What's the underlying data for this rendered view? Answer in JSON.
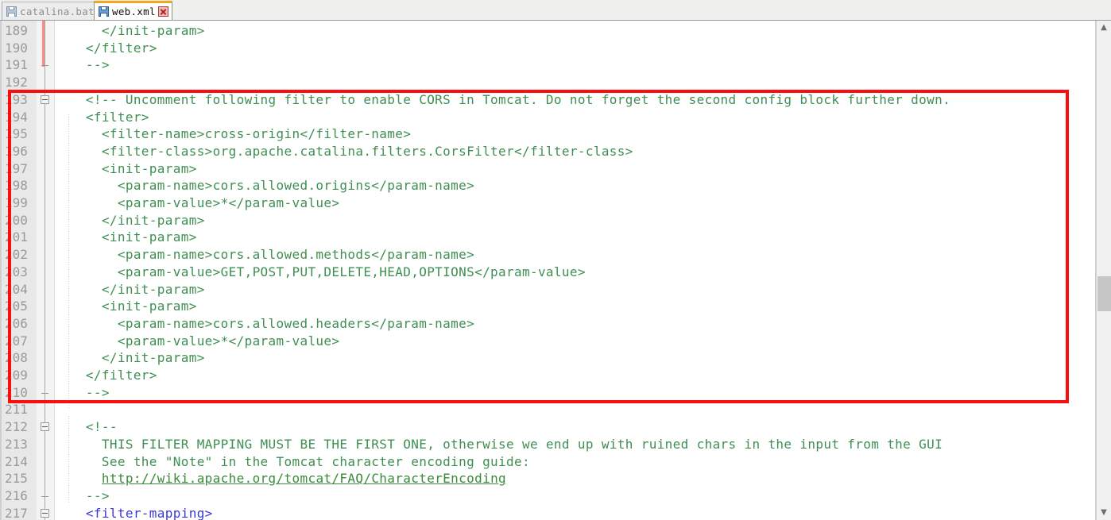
{
  "window": {
    "app": "notepad-style-xml-editor"
  },
  "tabs": [
    {
      "label": "catalina.bat",
      "active": false,
      "icon": "save-disk-icon",
      "close": "close-icon"
    },
    {
      "label": "web.xml",
      "active": true,
      "icon": "save-disk-icon",
      "close": "close-icon"
    }
  ],
  "editor": {
    "first_line": 189,
    "lines": [
      {
        "n": 189,
        "text": "      </init-param>",
        "style": "comment",
        "fold": "none"
      },
      {
        "n": 190,
        "text": "    </filter>",
        "style": "comment",
        "fold": "none"
      },
      {
        "n": 191,
        "text": "    -->",
        "style": "comment",
        "fold": "end"
      },
      {
        "n": 192,
        "text": "",
        "style": "comment",
        "fold": "none"
      },
      {
        "n": 193,
        "text": "    <!-- Uncomment following filter to enable CORS in Tomcat. Do not forget the second config block further down.",
        "style": "comment",
        "fold": "start"
      },
      {
        "n": 194,
        "text": "    <filter>",
        "style": "comment",
        "fold": "none"
      },
      {
        "n": 195,
        "text": "      <filter-name>cross-origin</filter-name>",
        "style": "comment",
        "fold": "none"
      },
      {
        "n": 196,
        "text": "      <filter-class>org.apache.catalina.filters.CorsFilter</filter-class>",
        "style": "comment",
        "fold": "none"
      },
      {
        "n": 197,
        "text": "      <init-param>",
        "style": "comment",
        "fold": "none"
      },
      {
        "n": 198,
        "text": "        <param-name>cors.allowed.origins</param-name>",
        "style": "comment",
        "fold": "none"
      },
      {
        "n": 199,
        "text": "        <param-value>*</param-value>",
        "style": "comment",
        "fold": "none"
      },
      {
        "n": 200,
        "text": "      </init-param>",
        "style": "comment",
        "fold": "none"
      },
      {
        "n": 201,
        "text": "      <init-param>",
        "style": "comment",
        "fold": "none"
      },
      {
        "n": 202,
        "text": "        <param-name>cors.allowed.methods</param-name>",
        "style": "comment",
        "fold": "none"
      },
      {
        "n": 203,
        "text": "        <param-value>GET,POST,PUT,DELETE,HEAD,OPTIONS</param-value>",
        "style": "comment",
        "fold": "none"
      },
      {
        "n": 204,
        "text": "      </init-param>",
        "style": "comment",
        "fold": "none"
      },
      {
        "n": 205,
        "text": "      <init-param>",
        "style": "comment",
        "fold": "none"
      },
      {
        "n": 206,
        "text": "        <param-name>cors.allowed.headers</param-name>",
        "style": "comment",
        "fold": "none"
      },
      {
        "n": 207,
        "text": "        <param-value>*</param-value>",
        "style": "comment",
        "fold": "none"
      },
      {
        "n": 208,
        "text": "      </init-param>",
        "style": "comment",
        "fold": "none"
      },
      {
        "n": 209,
        "text": "    </filter>",
        "style": "comment",
        "fold": "none"
      },
      {
        "n": 210,
        "text": "    -->",
        "style": "comment",
        "fold": "end"
      },
      {
        "n": 211,
        "text": "",
        "style": "comment",
        "fold": "none"
      },
      {
        "n": 212,
        "text": "    <!--",
        "style": "comment",
        "fold": "start"
      },
      {
        "n": 213,
        "text": "      THIS FILTER MAPPING MUST BE THE FIRST ONE, otherwise we end up with ruined chars in the input from the GUI",
        "style": "comment",
        "fold": "none"
      },
      {
        "n": 214,
        "text": "      See the \"Note\" in the Tomcat character encoding guide:",
        "style": "comment",
        "fold": "none"
      },
      {
        "n": 215,
        "text": "      http://wiki.apache.org/tomcat/FAQ/CharacterEncoding",
        "style": "link",
        "fold": "none"
      },
      {
        "n": 216,
        "text": "    -->",
        "style": "comment",
        "fold": "end"
      },
      {
        "n": 217,
        "text": "    <filter-mapping>",
        "style": "tag",
        "fold": "start"
      }
    ]
  },
  "annotation": {
    "type": "red-highlight-rectangle",
    "covers_lines": "193-210",
    "color": "#fb0d0d"
  },
  "scrollbar": {
    "up_arrow": "▲",
    "down_arrow": "▼",
    "thumb_position_pct": 52
  },
  "colors": {
    "comment": "#3f8f52",
    "tag": "#3a3ad4",
    "linenumber": "#9a9a9a",
    "gutter_bg": "#e8e8e8",
    "annotation": "#fb0d0d",
    "active_tab_accent": "#f5a623",
    "changebar": "#ff8a86"
  }
}
